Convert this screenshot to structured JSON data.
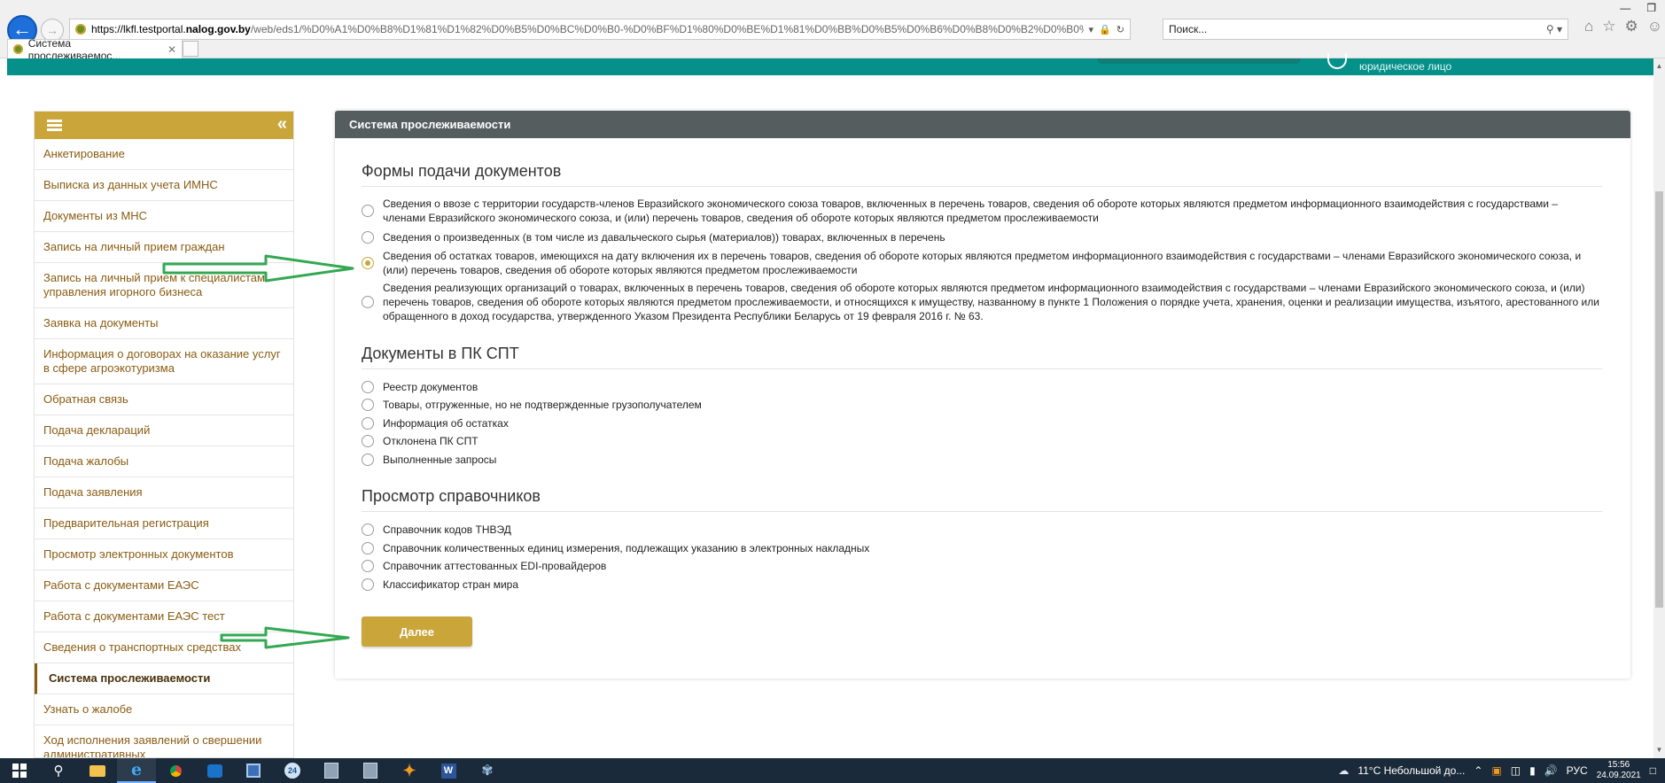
{
  "browser": {
    "url_host": "https://lkfl.testportal.",
    "url_domain": "nalog.gov.by",
    "url_path": "/web/eds1/%D0%A1%D0%B8%D1%81%D1%82%D0%B5%D0%BC%D0%B0-%D0%BF%D1%80%D0%BE%D1%81%D0%BB%D0%B5%D0%B6%D0%B8%D0%B2%D0%B0%D0%B5%D0%BC%D0%",
    "search_placeholder": "Поиск...",
    "tab_title": "Система прослеживаемос...",
    "icons": [
      "back-arrow-icon",
      "forward-arrow-icon",
      "lock-icon",
      "refresh-icon",
      "home-icon",
      "star-icon",
      "gear-icon",
      "smiley-icon"
    ]
  },
  "header": {
    "account_type": "юридическое лицо"
  },
  "sidebar": {
    "items": [
      "Анкетирование",
      "Выписка из данных учета ИМНС",
      "Документы из МНС",
      "Запись на личный прием граждан",
      "Запись на личный прием к специалистам управления игорного бизнеса",
      "Заявка на документы",
      "Информация о договорах на оказание услуг в сфере агроэкотуризма",
      "Обратная связь",
      "Подача деклараций",
      "Подача жалобы",
      "Подача заявления",
      "Предварительная регистрация",
      "Просмотр электронных документов",
      "Работа с документами ЕАЭС",
      "Работа с документами ЕАЭС тест",
      "Сведения о транспортных средствах",
      "Система прослеживаемости",
      "Узнать о жалобе",
      "Ход исполнения заявлений о свершении административных"
    ],
    "active_index": 16
  },
  "panel": {
    "title": "Система прослеживаемости",
    "sections": [
      {
        "title": "Формы подачи документов",
        "options": [
          "Сведения о ввозе с территории государств-членов Евразийского экономического союза товаров, включенных в перечень товаров, сведения об обороте которых являются предметом информационного взаимодействия с государствами – членами Евразийского экономического союза, и (или) перечень товаров, сведения об обороте которых являются предметом прослеживаемости",
          "Сведения о произведенных (в том числе из давальческого сырья (материалов)) товарах, включенных в перечень",
          "Сведения об остатках товаров, имеющихся на дату включения их в перечень товаров, сведения об обороте которых являются предметом информационного взаимодействия с государствами – членами Евразийского экономического союза, и (или) перечень товаров, сведения об обороте которых являются предметом прослеживаемости",
          "Сведения реализующих организаций о товарах, включенных в перечень товаров, сведения об обороте которых являются предметом информационного взаимодействия с государствами – членами Евразийского экономического союза, и (или) перечень товаров, сведения об обороте которых являются предметом прослеживаемости, и относящихся к имуществу, названному в пункте 1 Положения о порядке учета, хранения, оценки и реализации имущества, изъятого, арестованного или обращенного в доход государства, утвержденного Указом Президента Республики Беларусь от 19 февраля 2016 г. № 63."
        ]
      },
      {
        "title": "Документы в ПК СПТ",
        "options": [
          "Реестр документов",
          "Товары, отгруженные, но не подтвержденные грузополучателем",
          "Информация об остатках",
          "Отклонена ПК СПТ",
          "Выполненные запросы"
        ]
      },
      {
        "title": "Просмотр справочников",
        "options": [
          "Справочник кодов ТНВЭД",
          "Справочник количественных единиц измерения, подлежащих указанию в электронных накладных",
          "Справочник аттестованных EDI-провайдеров",
          "Классификатор стран мира"
        ]
      }
    ],
    "selected": "Сведения об остатках товаров, имеющихся на дату включения их в перечень товаров, сведения об обороте которых являются предметом информационного взаимодействия с государствами – членами Евразийского экономического союза, и (или) перечень товаров, сведения об обороте которых являются предметом прослеживаемости",
    "next_label": "Далее"
  },
  "taskbar": {
    "weather": "11°C  Небольшой до...",
    "lang": "РУС",
    "time": "15:56",
    "date": "24.09.2021",
    "badge": "24"
  },
  "colors": {
    "teal": "#05918a",
    "gold": "#c9a53a",
    "link_brown": "#8a5c12",
    "panel_header": "#555d5f",
    "arrow_green": "#33a852"
  }
}
